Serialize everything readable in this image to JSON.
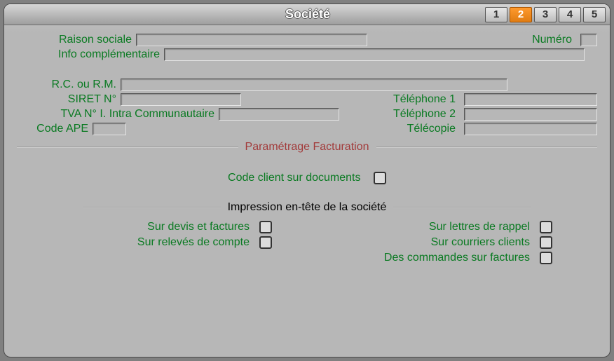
{
  "window": {
    "title": "Société"
  },
  "pager": {
    "items": [
      "1",
      "2",
      "3",
      "4",
      "5"
    ],
    "active_index": 1
  },
  "labels": {
    "raison_sociale": "Raison sociale",
    "numero": "Numéro",
    "info_compl": "Info complémentaire",
    "rc_rm": "R.C. ou R.M.",
    "siret": "SIRET N°",
    "tva_intra": "TVA N° I. Intra Communautaire",
    "code_ape": "Code APE",
    "tel1": "Téléphone 1",
    "tel2": "Téléphone 2",
    "fax": "Télécopie"
  },
  "sections": {
    "facturation": "Paramétrage Facturation",
    "code_client_docs": "Code client sur documents",
    "impression": "Impression en-tête de la société",
    "sur_devis_factures": "Sur devis et factures",
    "sur_releves": "Sur relevés de compte",
    "sur_lettres_rappel": "Sur lettres de rappel",
    "sur_courriers_clients": "Sur courriers clients",
    "commandes_sur_factures": "Des commandes sur factures"
  },
  "values": {
    "raison_sociale": "",
    "numero": "",
    "info_compl": "",
    "rc_rm": "",
    "siret": "",
    "tva_intra": "",
    "code_ape": "",
    "tel1": "",
    "tel2": "",
    "fax": ""
  },
  "checkboxes": {
    "code_client_docs": false,
    "sur_devis_factures": false,
    "sur_releves": false,
    "sur_lettres_rappel": false,
    "sur_courriers_clients": false,
    "commandes_sur_factures": false
  }
}
